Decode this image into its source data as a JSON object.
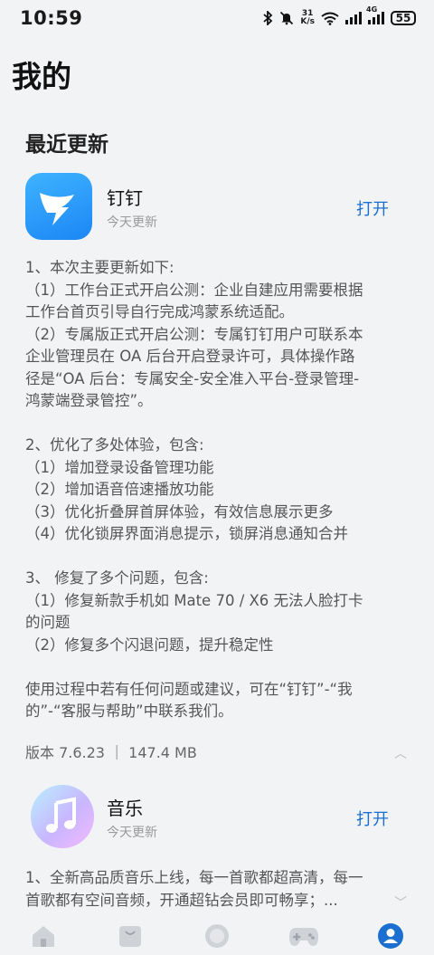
{
  "status_bar": {
    "time": "10:59",
    "net_speed_value": "31",
    "net_speed_unit": "K/s",
    "battery": "55"
  },
  "page_title": "我的",
  "section_title": "最近更新",
  "apps": [
    {
      "name": "钉钉",
      "updated": "今天更新",
      "action": "打开",
      "icon": "dingtalk-icon",
      "notes": [
        "1、本次主要更新如下:",
        "（1）工作台正式开启公测：企业自建应用需要根据",
        "工作台首页引导自行完成鸿蒙系统适配。",
        "（2）专属版正式开启公测：专属钉钉用户可联系本",
        "企业管理员在 OA 后台开启登录许可，具体操作路",
        "径是“OA 后台：专属安全-安全准入平台-登录管理-",
        "鸿蒙端登录管控”。",
        "",
        "2、优化了多处体验，包含:",
        "（1）增加登录设备管理功能",
        "（2）增加语音倍速播放功能",
        "（3）优化折叠屏首屏体验，有效信息展示更多",
        "（4）优化锁屏界面消息提示，锁屏消息通知合并",
        "",
        "3、 修复了多个问题，包含:",
        "（1）修复新款手机如 Mate 70 / X6 无法人脸打卡",
        "的问题",
        "（2）修复多个闪退问题，提升稳定性",
        "",
        "使用过程中若有任何问题或建议，可在“钉钉”-“我",
        "的”-“客服与帮助”中联系我们。"
      ],
      "version": "版本 7.6.23 ｜ 147.4 MB"
    },
    {
      "name": "音乐",
      "updated": "今天更新",
      "action": "打开",
      "icon": "music-icon",
      "notes": [
        "1、全新高品质音乐上线，每一首歌都超高清，每一",
        "首歌都有空间音频，开通超钻会员即可畅享；..."
      ]
    }
  ],
  "colors": {
    "accent": "#1a6fd0",
    "background": "#f1f3f5",
    "nav_active": "#1a6fd0"
  }
}
